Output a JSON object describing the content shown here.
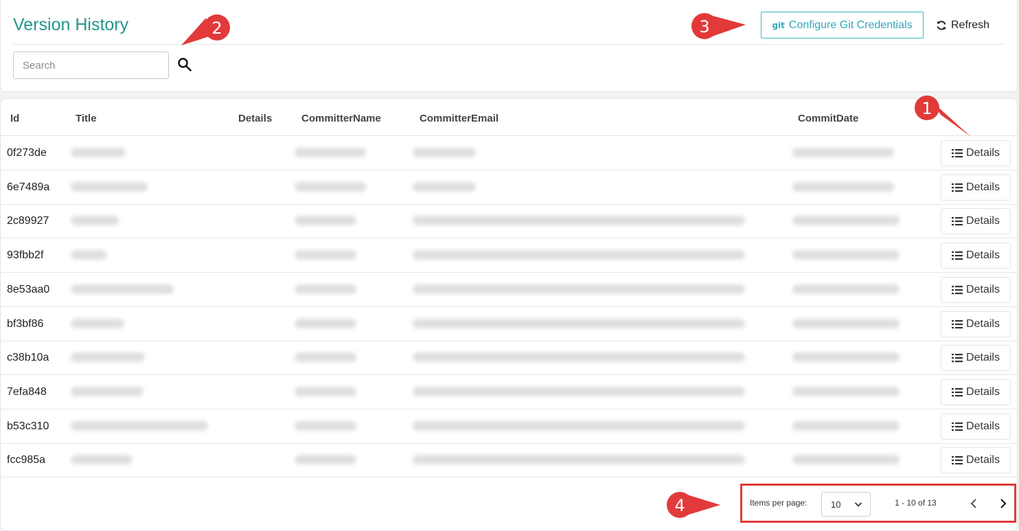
{
  "header": {
    "title": "Version History",
    "git_button_icon": "git",
    "git_button_label": "Configure Git Credentials",
    "refresh_label": "Refresh"
  },
  "search": {
    "placeholder": "Search",
    "value": ""
  },
  "table": {
    "columns": [
      "Id",
      "Title",
      "Details",
      "CommitterName",
      "CommitterEmail",
      "CommitDate"
    ],
    "details_label": "Details",
    "rows": [
      {
        "id": "0f273de"
      },
      {
        "id": "6e7489a"
      },
      {
        "id": "2c89927"
      },
      {
        "id": "93fbb2f"
      },
      {
        "id": "8e53aa0"
      },
      {
        "id": "bf3bf86"
      },
      {
        "id": "c38b10a"
      },
      {
        "id": "7efa848"
      },
      {
        "id": "b53c310"
      },
      {
        "id": "fcc985a"
      }
    ]
  },
  "pagination": {
    "items_per_page_label": "Items per page:",
    "items_per_page": "10",
    "range": "1 - 10 of 13"
  },
  "callouts": [
    "1",
    "2",
    "3",
    "4"
  ],
  "colors": {
    "accent": "#23958a",
    "git": "#2fa9bd",
    "callout": "#e23a3a"
  }
}
